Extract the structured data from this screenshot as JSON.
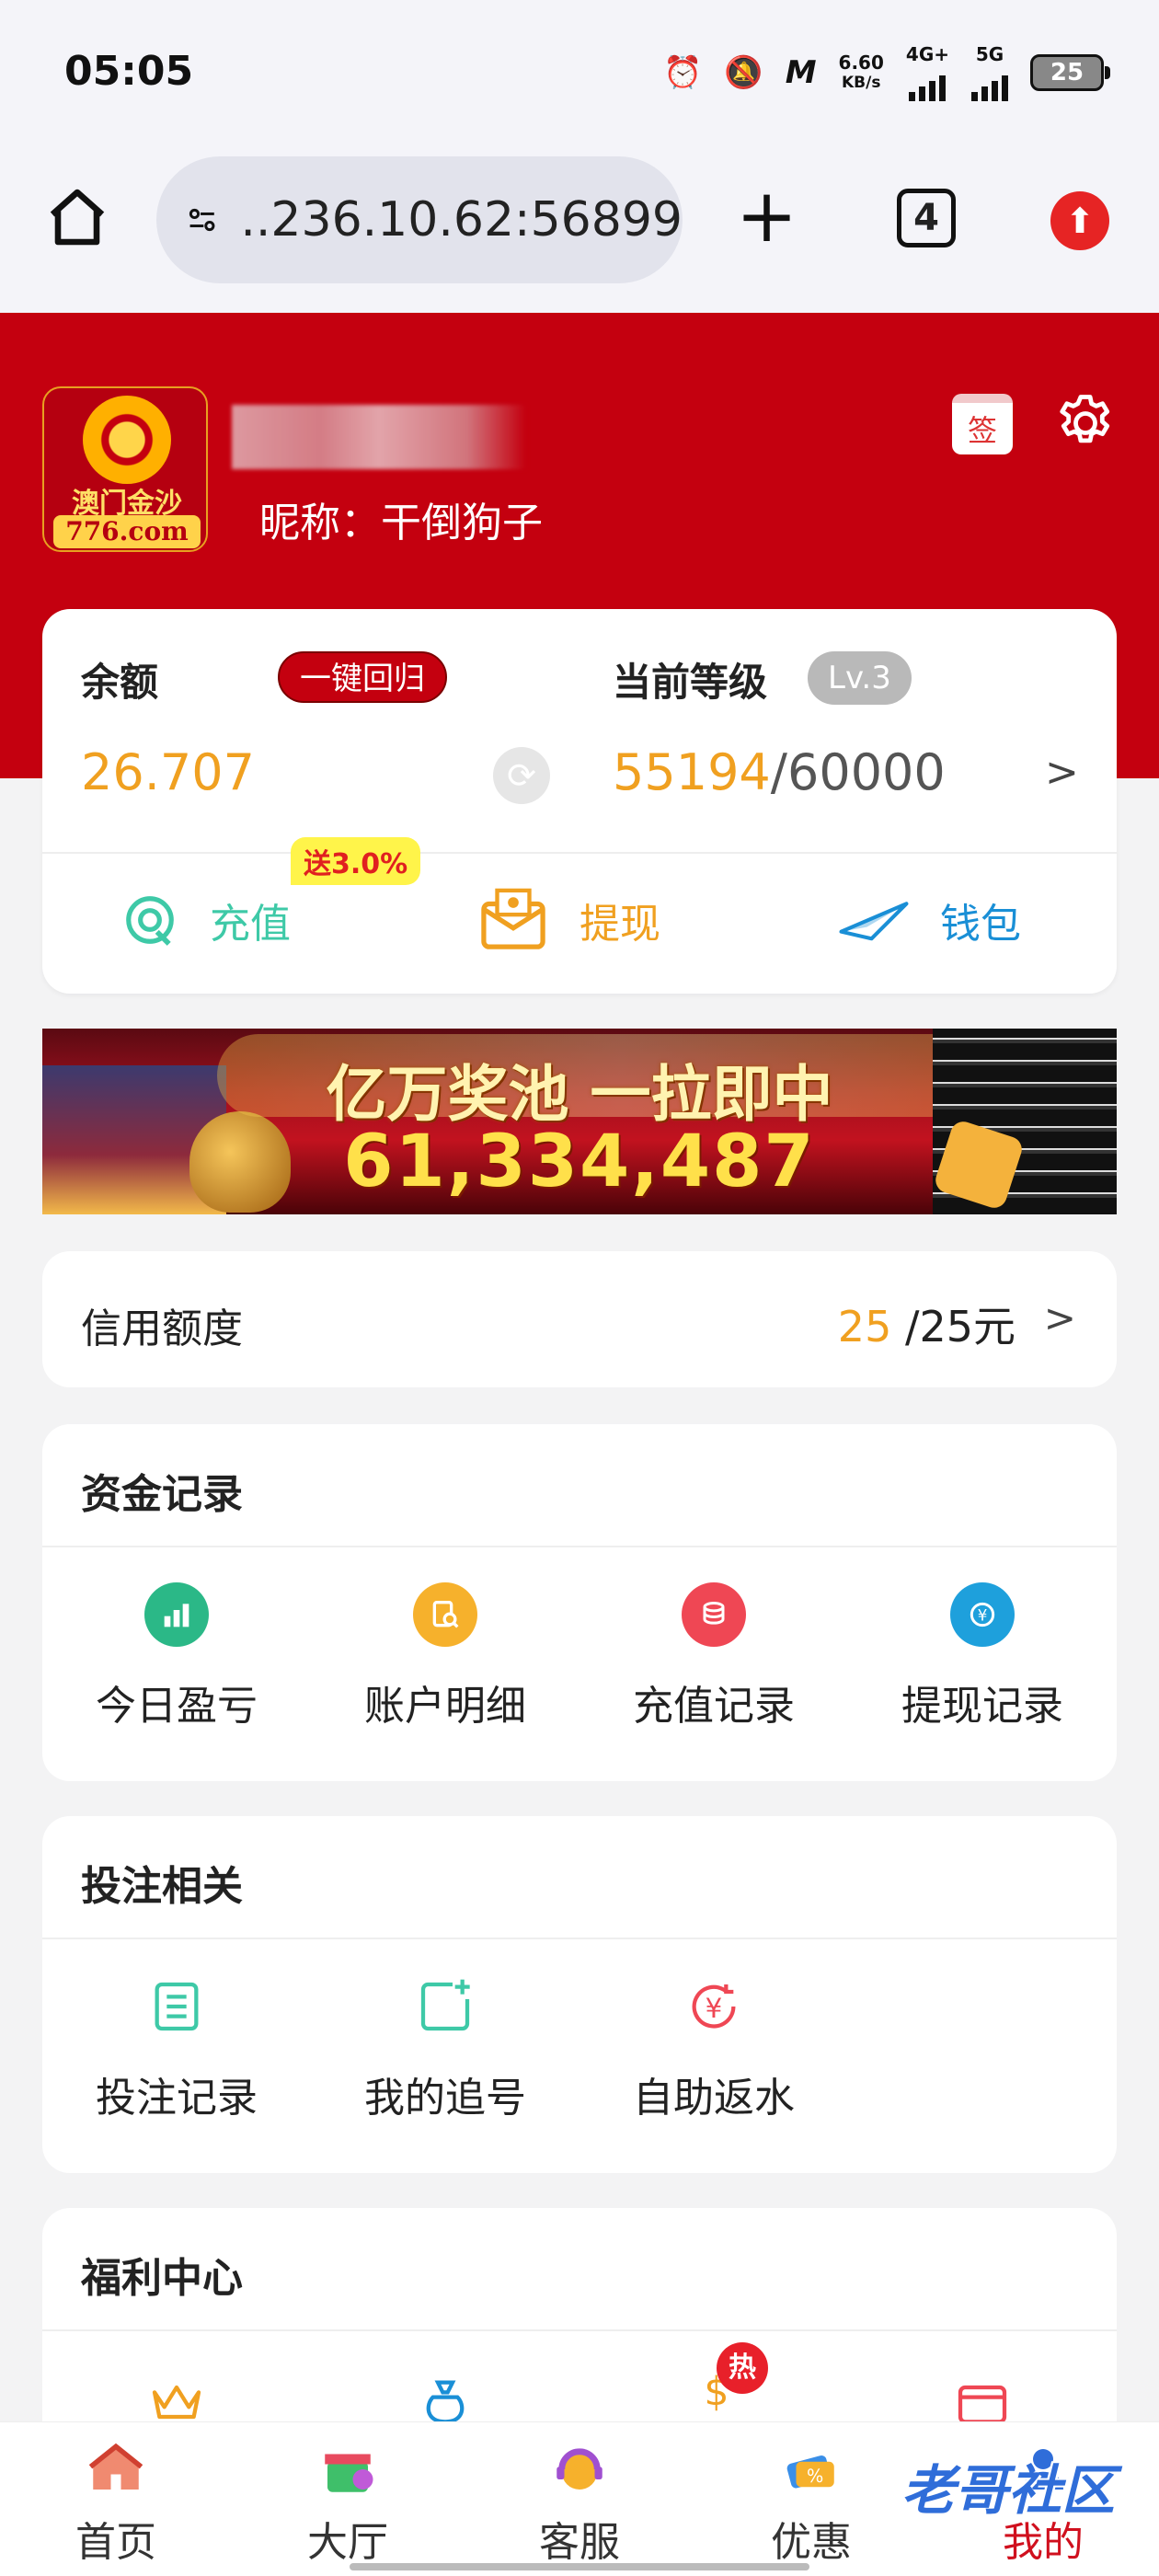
{
  "status_bar": {
    "time": "05:05",
    "net_speed_value": "6.60",
    "net_speed_unit": "KB/s",
    "net1": "4G+",
    "net2": "5G",
    "battery": "25"
  },
  "browser": {
    "url": "..236.10.62:56899",
    "tab_count": "4"
  },
  "profile": {
    "logo_text": "澳门金沙",
    "logo_domain": "776.com",
    "nickname": "昵称：干倒狗子",
    "sign_label": "签"
  },
  "balance": {
    "label": "余额",
    "recall_button": "一键回归",
    "value": "26.707",
    "level_label": "当前等级",
    "level_badge": "Lv.3",
    "level_current": "55194",
    "level_max": "/60000",
    "arrow": ">"
  },
  "actions": {
    "bonus_tag": "送3.0%",
    "recharge": "充值",
    "withdraw": "提现",
    "wallet": "钱包"
  },
  "banner": {
    "title": "亿万奖池 一拉即中",
    "amount": "61,334,487"
  },
  "credit": {
    "label": "信用额度",
    "current": "25",
    "total": " /25元",
    "arrow": ">"
  },
  "funds": {
    "title": "资金记录",
    "items": [
      "今日盈亏",
      "账户明细",
      "充值记录",
      "提现记录"
    ]
  },
  "betting": {
    "title": "投注相关",
    "items": [
      "投注记录",
      "我的追号",
      "自助返水"
    ]
  },
  "welfare": {
    "title": "福利中心",
    "hot_label": "热"
  },
  "nav": {
    "items": [
      "首页",
      "大厅",
      "客服",
      "优惠",
      "我的"
    ]
  },
  "watermark": "老哥社区",
  "colors": {
    "brand_red": "#c4000f",
    "accent_orange": "#f0a020",
    "teal": "#3ec9a7",
    "blue": "#1a8fd6"
  }
}
